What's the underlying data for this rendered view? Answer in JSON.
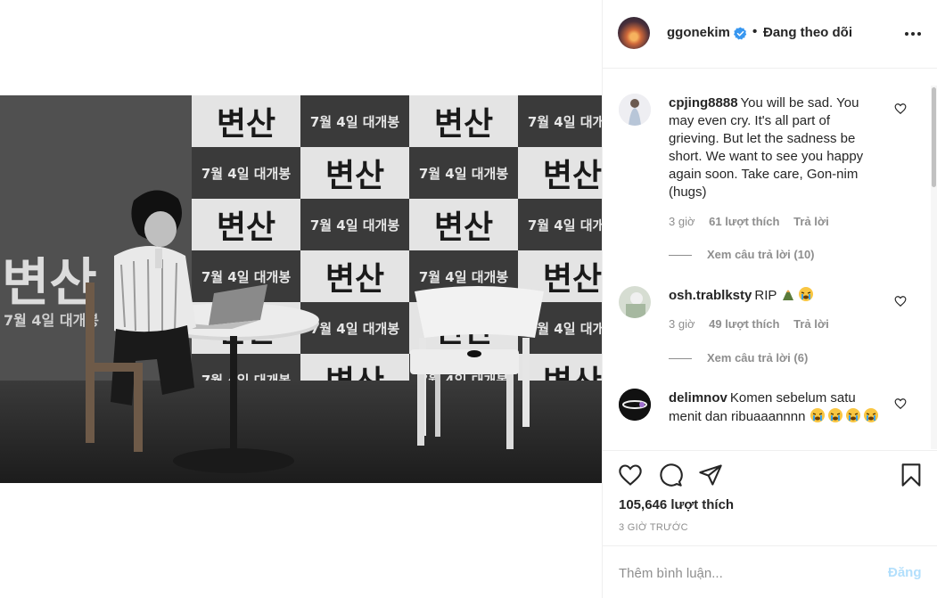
{
  "post": {
    "username": "ggonekim",
    "follow_separator": "•",
    "follow_status": "Đang theo dõi",
    "likes": "105,646 lượt thích",
    "posted_ago": "3 GIỜ TRƯỚC",
    "photo_signs": {
      "title": "변산",
      "date": "7월 4일 대개봉"
    }
  },
  "comments": [
    {
      "username": "cpjing8888",
      "text": "You will be sad. You may even cry. It's all part of grieving. But let the sadness be short. We want to see you happy again soon. Take care, Gon-nim (hugs)",
      "time": "3 giờ",
      "likes": "61 lượt thích",
      "reply": "Trả lời",
      "view_replies": "Xem câu trả lời (10)"
    },
    {
      "username": "osh.trablksty",
      "text": "RIP",
      "emojis": [
        "hands-emoji",
        "crying-emoji"
      ],
      "time": "3 giờ",
      "likes": "49 lượt thích",
      "reply": "Trả lời",
      "view_replies": "Xem câu trả lời (6)"
    },
    {
      "username": "delimnov",
      "text": "Komen sebelum satu menit dan ribuaaannnn",
      "emojis": [
        "crying-emoji",
        "crying-emoji",
        "crying-emoji",
        "crying-emoji"
      ]
    }
  ],
  "add_comment": {
    "placeholder": "Thêm bình luận...",
    "post_label": "Đăng"
  },
  "icons": {
    "more": "more-options-icon",
    "verified": "verified-badge-icon",
    "like": "heart-icon",
    "comment": "comment-icon",
    "share": "share-icon",
    "save": "bookmark-icon"
  },
  "colors": {
    "verified_blue": "#3897f0",
    "post_button_disabled": "#b2dffc",
    "meta_gray": "#8e8e8e",
    "text": "#262626"
  }
}
